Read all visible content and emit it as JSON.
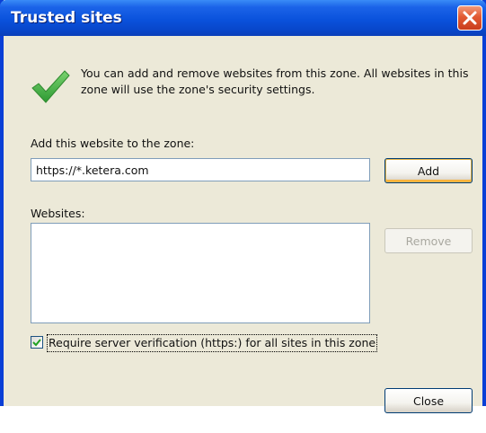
{
  "window": {
    "title": "Trusted sites"
  },
  "info": {
    "text": "You can add and remove websites from this zone. All websites in this zone will use the zone's security settings.",
    "icon": "checkmark-icon"
  },
  "add_section": {
    "label": "Add this website to the zone:",
    "url_value": "https://*.ketera.com",
    "add_label": "Add"
  },
  "websites": {
    "label": "Websites:",
    "items": [],
    "remove_label": "Remove"
  },
  "verification": {
    "checked": true,
    "label": "Require server verification (https:) for all sites in this zone"
  },
  "footer": {
    "close_label": "Close"
  },
  "colors": {
    "title_bar": "#0a52dc",
    "close_button": "#e25a32",
    "check_green": "#3cb043",
    "dialog_bg": "#ece9d8"
  }
}
